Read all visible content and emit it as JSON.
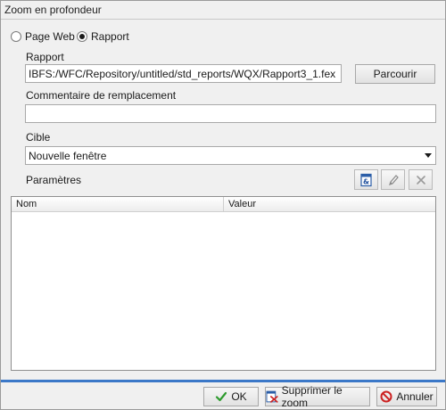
{
  "window": {
    "title": "Zoom en profondeur"
  },
  "link_type": {
    "options": [
      {
        "label": "Page Web",
        "checked": false
      },
      {
        "label": "Rapport",
        "checked": true
      }
    ]
  },
  "report": {
    "label": "Rapport",
    "value": "IBFS:/WFC/Repository/untitled/std_reports/WQX/Rapport3_1.fex",
    "browse_label": "Parcourir"
  },
  "alt_comment": {
    "label": "Commentaire de remplacement",
    "value": ""
  },
  "target": {
    "label": "Cible",
    "value": "Nouvelle fenêtre"
  },
  "parameters": {
    "label": "Paramètres",
    "columns": [
      "Nom",
      "Valeur"
    ],
    "rows": [],
    "toolbar": [
      "add-parameter-icon",
      "edit-icon",
      "delete-icon"
    ]
  },
  "footer": {
    "ok_label": "OK",
    "remove_label": "Supprimer le zoom",
    "cancel_label": "Annuler"
  },
  "colors": {
    "accent": "#3b78c8",
    "ok_green": "#2e9b2e",
    "cancel_red": "#cc2222"
  }
}
